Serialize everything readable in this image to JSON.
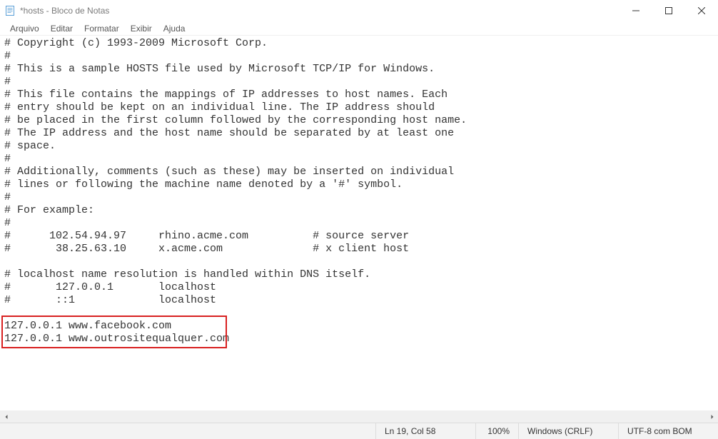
{
  "window": {
    "title": "*hosts - Bloco de Notas"
  },
  "menus": {
    "file": "Arquivo",
    "edit": "Editar",
    "format": "Formatar",
    "view": "Exibir",
    "help": "Ajuda"
  },
  "editor": {
    "content": "# Copyright (c) 1993-2009 Microsoft Corp.\n#\n# This is a sample HOSTS file used by Microsoft TCP/IP for Windows.\n#\n# This file contains the mappings of IP addresses to host names. Each\n# entry should be kept on an individual line. The IP address should\n# be placed in the first column followed by the corresponding host name.\n# The IP address and the host name should be separated by at least one\n# space.\n#\n# Additionally, comments (such as these) may be inserted on individual\n# lines or following the machine name denoted by a '#' symbol.\n#\n# For example:\n#\n#      102.54.94.97     rhino.acme.com          # source server\n#       38.25.63.10     x.acme.com              # x client host\n\n# localhost name resolution is handled within DNS itself.\n#\t127.0.0.1       localhost\n#\t::1             localhost\n\n127.0.0.1 www.facebook.com\n127.0.0.1 www.outrositequalquer.com"
  },
  "status": {
    "position": "Ln 19, Col 58",
    "zoom": "100%",
    "line_ending": "Windows (CRLF)",
    "encoding": "UTF-8 com BOM"
  }
}
